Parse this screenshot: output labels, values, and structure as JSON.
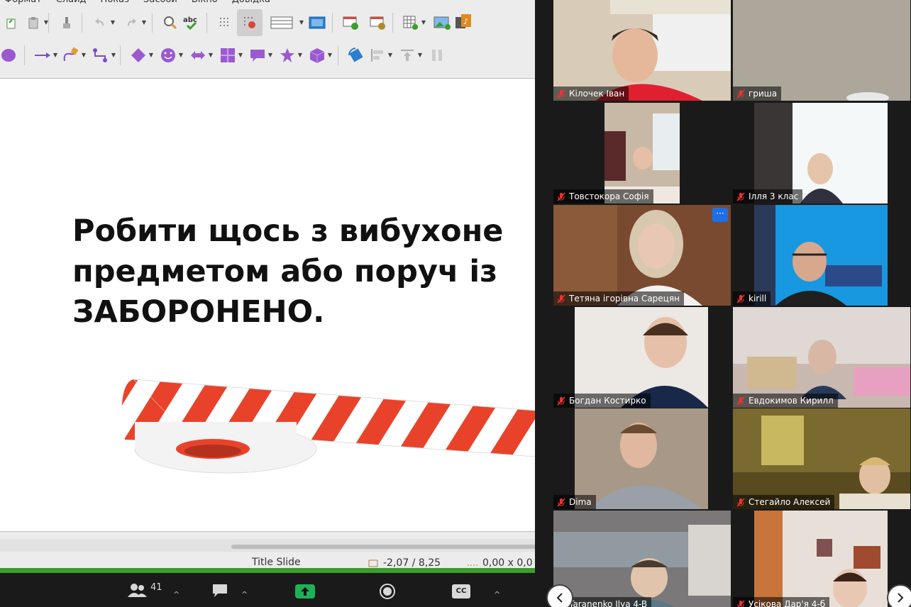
{
  "impress": {
    "menu": [
      "Формат",
      "Слайд",
      "Показ",
      "Засоби",
      "Вікно",
      "Довідка"
    ],
    "toolbar1": [
      "clone-formatting-icon",
      "paste-icon",
      "clear-formatting-icon",
      "undo-icon",
      "redo-icon",
      "find-replace-icon",
      "spellcheck-icon",
      "grid-icon",
      "snap-grid-icon",
      "display-views-icon",
      "master-slide-icon",
      "new-slide-icon",
      "duplicate-slide-icon",
      "table-icon",
      "image-icon",
      "media-icon"
    ],
    "toolbar2": [
      "ellipse-icon",
      "line-arrow-icon",
      "curve-icon",
      "connector-icon",
      "diamond-icon",
      "smiley-icon",
      "double-arrow-icon",
      "flowchart-icon",
      "callout-icon",
      "star-icon",
      "cube-icon",
      "transform-icon",
      "align-icon",
      "arrange-icon",
      "distribute-icon"
    ],
    "slide": {
      "text": "Робити щось з вибухоне\nпредметом або поруч із\nЗАБОРОНЕНО."
    },
    "status": {
      "layout": "Title Slide",
      "position": "-2,07 / 8,25",
      "size": "0,00 x 0,0"
    },
    "colors": {
      "tape_red": "#e8432a",
      "accent_green": "#3c9d2e"
    }
  },
  "gallery": {
    "participants": [
      {
        "name": "Кілочек Іван"
      },
      {
        "name": "гриша"
      },
      {
        "name": "Товстокора Софія"
      },
      {
        "name": "Ілля 3 клас"
      },
      {
        "name": "Тетяна ігорівна Сарецян"
      },
      {
        "name": "kirill"
      },
      {
        "name": "Богдан Костирко"
      },
      {
        "name": "Евдокимов Кирилл"
      },
      {
        "name": "Dima"
      },
      {
        "name": "Стегайло Алексей"
      },
      {
        "name": "Taranenko Ilya 4-B"
      },
      {
        "name": "Усікова Дар'я 4-б"
      }
    ],
    "more_label": "···"
  },
  "controls": {
    "participants_count": "41",
    "cc_label": "CC"
  }
}
